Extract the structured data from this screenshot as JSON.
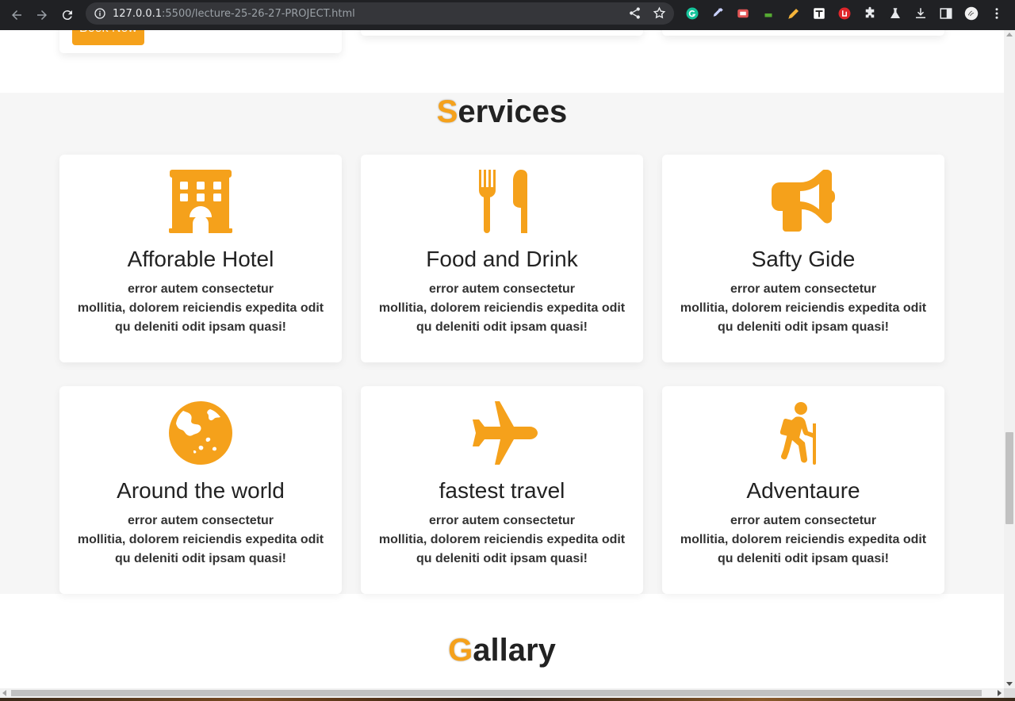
{
  "browser": {
    "url_host": "127.0.0.1",
    "url_rest": ":5500/lecture-25-26-27-PROJECT.html",
    "extensions": [
      "grammarly-icon",
      "eyedropper-icon",
      "ext-red-icon",
      "ext-hat-icon",
      "pencil-icon",
      "ext-tt-icon",
      "ext-stop-icon",
      "puzzle-icon",
      "flask-icon",
      "download-icon",
      "sidebar-icon",
      "avatar",
      "menu-icon"
    ]
  },
  "prev_section": {
    "book_label": "Book Now"
  },
  "services": {
    "title_first": "S",
    "title_rest": "ervices",
    "cards": [
      {
        "icon": "hotel-icon",
        "title": "Afforable Hotel",
        "line1": "error autem consectetur",
        "line2": "mollitia, dolorem reiciendis expedita odit",
        "line3": "qu deleniti odit ipsam quasi!"
      },
      {
        "icon": "utensils-icon",
        "title": "Food and Drink",
        "line1": "error autem consectetur",
        "line2": "mollitia, dolorem reiciendis expedita odit",
        "line3": "qu deleniti odit ipsam quasi!"
      },
      {
        "icon": "bullhorn-icon",
        "title": "Safty Gide",
        "line1": "error autem consectetur",
        "line2": "mollitia, dolorem reiciendis expedita odit",
        "line3": "qu deleniti odit ipsam quasi!"
      },
      {
        "icon": "globe-icon",
        "title": "Around the world",
        "line1": "error autem consectetur",
        "line2": "mollitia, dolorem reiciendis expedita odit",
        "line3": "qu deleniti odit ipsam quasi!"
      },
      {
        "icon": "plane-icon",
        "title": "fastest travel",
        "line1": "error autem consectetur",
        "line2": "mollitia, dolorem reiciendis expedita odit",
        "line3": "qu deleniti odit ipsam quasi!"
      },
      {
        "icon": "hiking-icon",
        "title": "Adventaure",
        "line1": "error autem consectetur",
        "line2": "mollitia, dolorem reiciendis expedita odit",
        "line3": "qu deleniti odit ipsam quasi!"
      }
    ]
  },
  "gallery": {
    "title_first": "G",
    "title_rest": "allary"
  },
  "colors": {
    "accent": "#f5a11b",
    "section_bg": "#f6f6f6",
    "chrome_bg": "#202124"
  }
}
